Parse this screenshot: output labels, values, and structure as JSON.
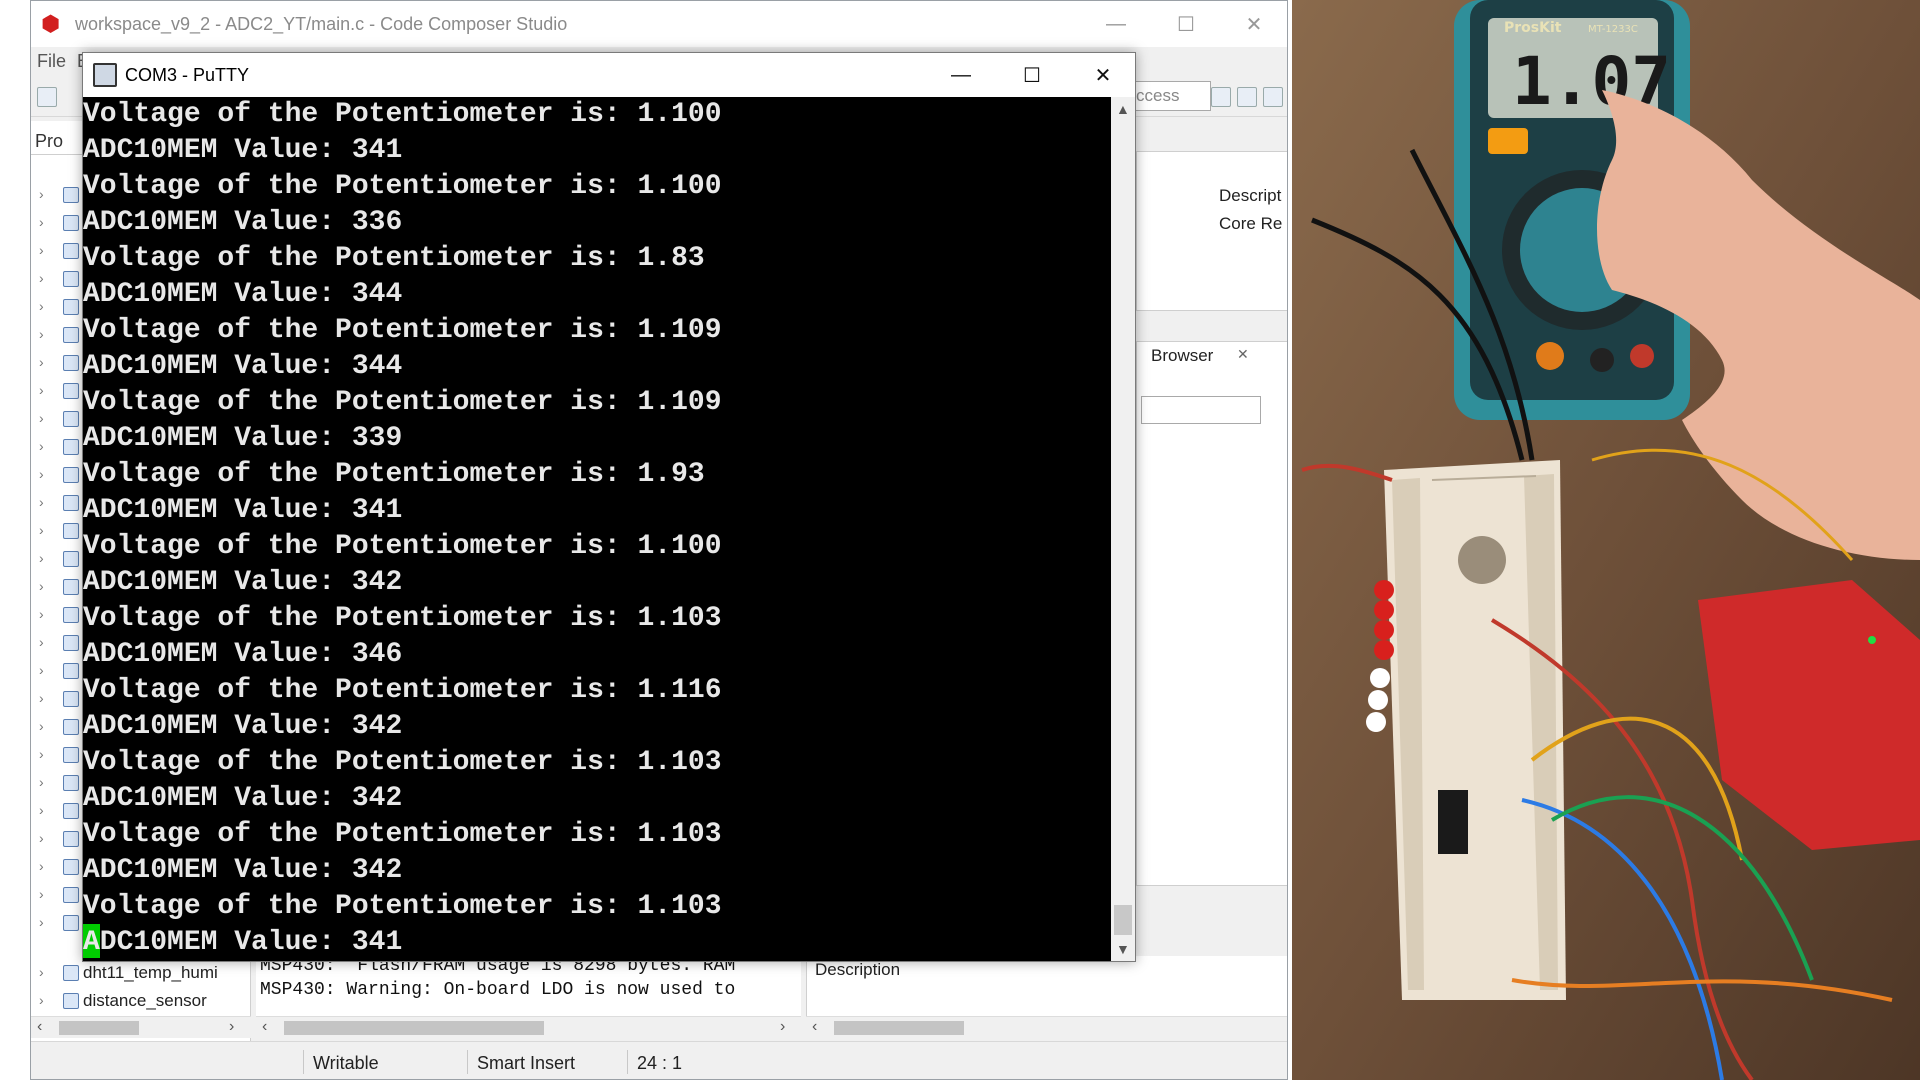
{
  "ccs": {
    "title": "workspace_v9_2 - ADC2_YT/main.c - Code Composer Studio",
    "menu": [
      "File",
      "E"
    ],
    "quick_access": "ccess",
    "project_tab": "Pro",
    "projects_visible": [
      "dht11_temp_humi",
      "distance_sensor"
    ],
    "right_panel": {
      "col1": "Descript",
      "col2": "Core Re"
    },
    "browser_tab": "Browser",
    "console_lines": [
      "MSP430:  Flash/FRAM usage is 8298 bytes. RAM",
      "MSP430: Warning: On-board LDO is now used to"
    ],
    "problems_header": "Description",
    "status": {
      "mode": "Writable",
      "insert": "Smart Insert",
      "position": "24 : 1"
    }
  },
  "putty": {
    "title": "COM3 - PuTTY",
    "lines": [
      "Voltage of the Potentiometer is: 1.100",
      "ADC10MEM Value: 341",
      "Voltage of the Potentiometer is: 1.100",
      "ADC10MEM Value: 336",
      "Voltage of the Potentiometer is: 1.83",
      "ADC10MEM Value: 344",
      "Voltage of the Potentiometer is: 1.109",
      "ADC10MEM Value: 344",
      "Voltage of the Potentiometer is: 1.109",
      "ADC10MEM Value: 339",
      "Voltage of the Potentiometer is: 1.93",
      "ADC10MEM Value: 341",
      "Voltage of the Potentiometer is: 1.100",
      "ADC10MEM Value: 342",
      "Voltage of the Potentiometer is: 1.103",
      "ADC10MEM Value: 346",
      "Voltage of the Potentiometer is: 1.116",
      "ADC10MEM Value: 342",
      "Voltage of the Potentiometer is: 1.103",
      "ADC10MEM Value: 342",
      "Voltage of the Potentiometer is: 1.103",
      "ADC10MEM Value: 342",
      "Voltage of the Potentiometer is: 1.103",
      "ADC10MEM Value: 341"
    ]
  },
  "photo": {
    "meter_brand": "ProsKit",
    "meter_model": "MT-1233C",
    "meter_reading": "1.07"
  }
}
